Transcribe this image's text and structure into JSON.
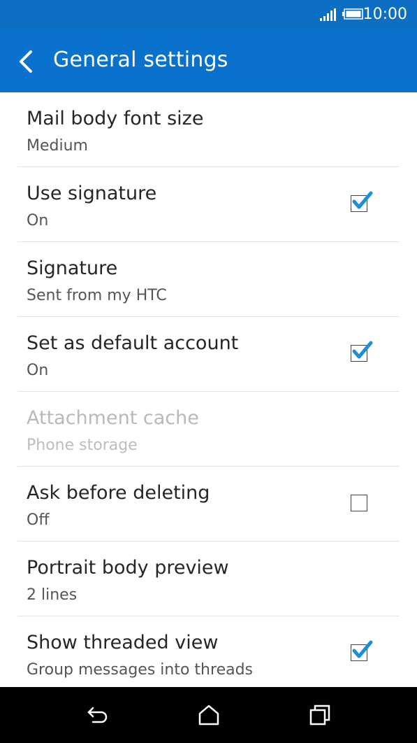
{
  "status_bar": {
    "time": "10:00"
  },
  "app_bar": {
    "title": "General settings"
  },
  "settings": [
    {
      "title": "Mail body font size",
      "subtitle": "Medium",
      "checkbox": null,
      "disabled": false
    },
    {
      "title": "Use signature",
      "subtitle": "On",
      "checkbox": true,
      "disabled": false
    },
    {
      "title": "Signature",
      "subtitle": "Sent from my HTC",
      "checkbox": null,
      "disabled": false
    },
    {
      "title": "Set as default account",
      "subtitle": "On",
      "checkbox": true,
      "disabled": false
    },
    {
      "title": "Attachment cache",
      "subtitle": "Phone storage",
      "checkbox": null,
      "disabled": true
    },
    {
      "title": "Ask before deleting",
      "subtitle": "Off",
      "checkbox": false,
      "disabled": false
    },
    {
      "title": "Portrait body preview",
      "subtitle": "2 lines",
      "checkbox": null,
      "disabled": false
    },
    {
      "title": "Show threaded view",
      "subtitle": "Group messages into threads",
      "checkbox": true,
      "disabled": false
    }
  ],
  "colors": {
    "accent": "#0a72cc",
    "check": "#1a8fd6"
  },
  "icons": {
    "back": "back-arrow-icon",
    "signal": "signal-icon",
    "battery": "battery-icon",
    "nav_back": "nav-back-icon",
    "nav_home": "home-icon",
    "nav_recents": "recents-icon"
  }
}
